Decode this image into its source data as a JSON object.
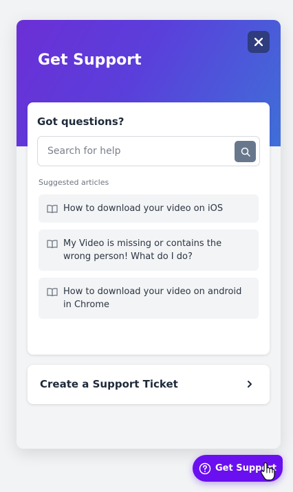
{
  "header": {
    "title": "Get Support",
    "close_icon": "close-icon"
  },
  "card": {
    "title": "Got questions?",
    "search": {
      "placeholder": "Search for help",
      "value": "",
      "icon": "search-icon"
    },
    "suggested_label": "Suggested articles",
    "articles": [
      {
        "label": "How to download your video on iOS",
        "icon": "book-icon"
      },
      {
        "label": "My Video is missing or contains the wrong person! What do I do?",
        "icon": "book-icon"
      },
      {
        "label": "How to download your video on android in Chrome",
        "icon": "book-icon"
      }
    ]
  },
  "ticket": {
    "label": "Create a Support Ticket",
    "icon": "chevron-right-icon"
  },
  "launcher": {
    "label": "Get Support",
    "icon": "help-circle-icon"
  },
  "colors": {
    "hero_gradient_start": "#6b2fd6",
    "hero_gradient_end": "#3f6fd8",
    "launcher": "#6a0ff0",
    "close_button": "#2f3c7e",
    "search_button": "#69778d"
  }
}
